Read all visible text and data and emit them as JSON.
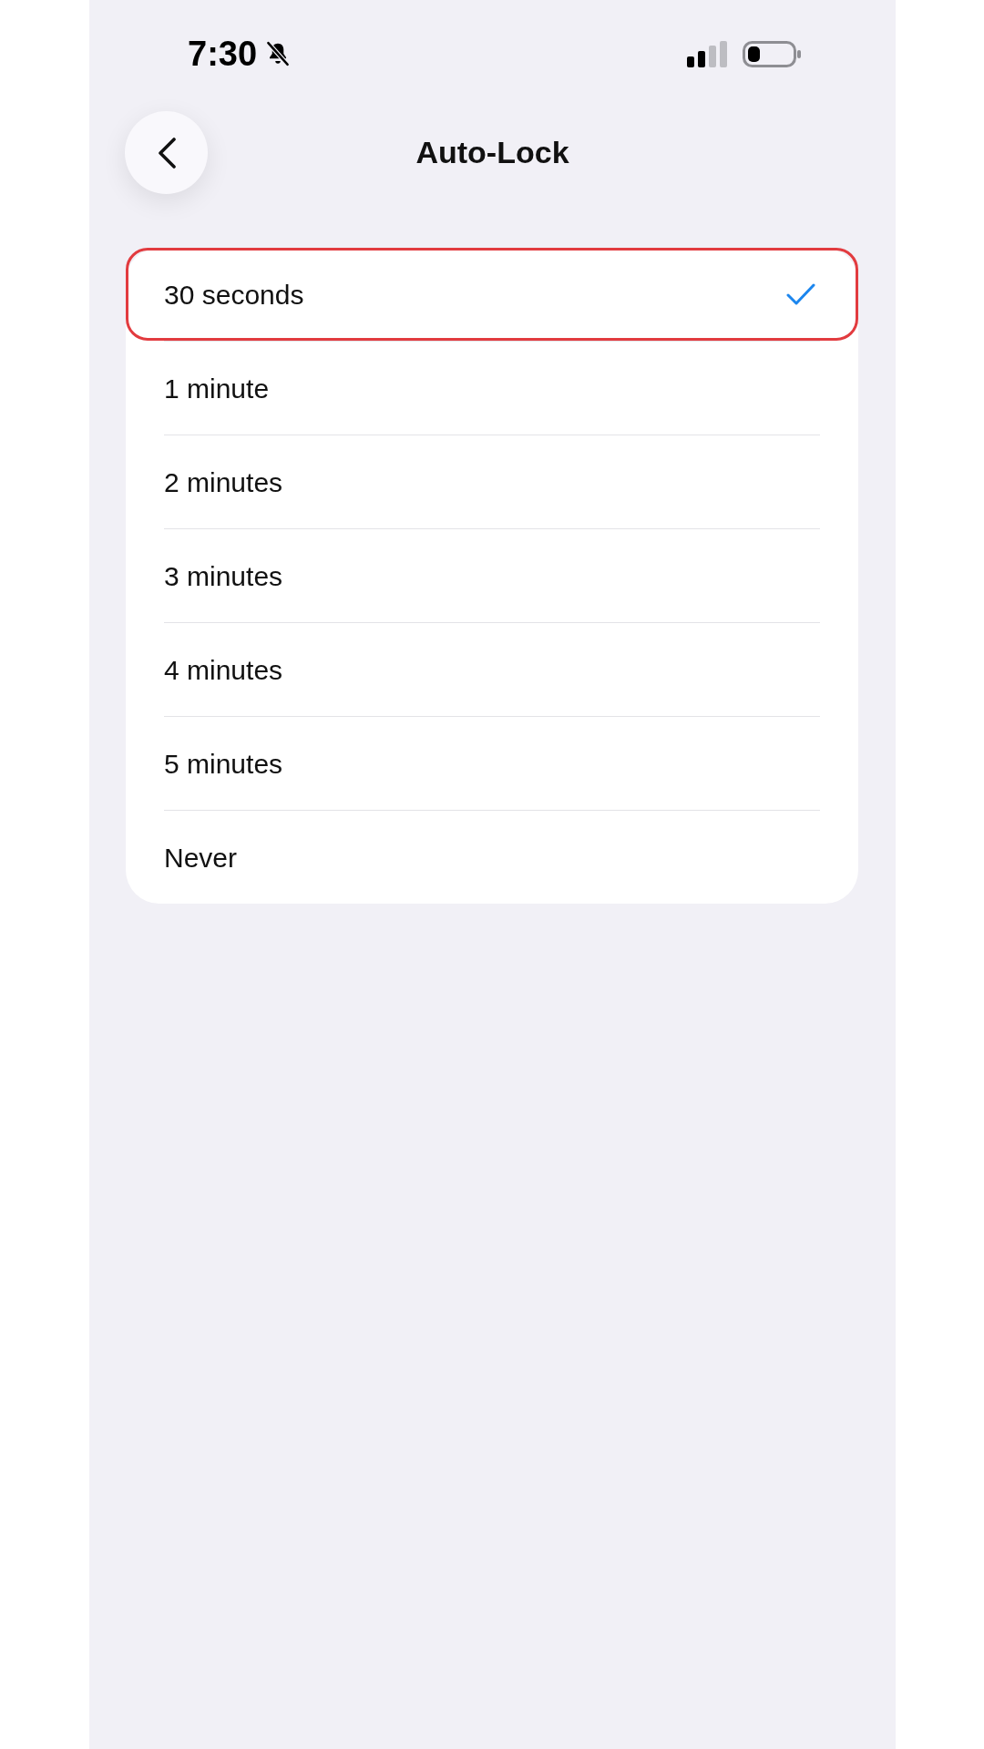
{
  "status_bar": {
    "time": "7:30"
  },
  "header": {
    "title": "Auto-Lock"
  },
  "options": [
    {
      "label": "30 seconds",
      "selected": true,
      "highlighted": true
    },
    {
      "label": "1 minute",
      "selected": false,
      "highlighted": false
    },
    {
      "label": "2 minutes",
      "selected": false,
      "highlighted": false
    },
    {
      "label": "3 minutes",
      "selected": false,
      "highlighted": false
    },
    {
      "label": "4 minutes",
      "selected": false,
      "highlighted": false
    },
    {
      "label": "5 minutes",
      "selected": false,
      "highlighted": false
    },
    {
      "label": "Never",
      "selected": false,
      "highlighted": false
    }
  ]
}
